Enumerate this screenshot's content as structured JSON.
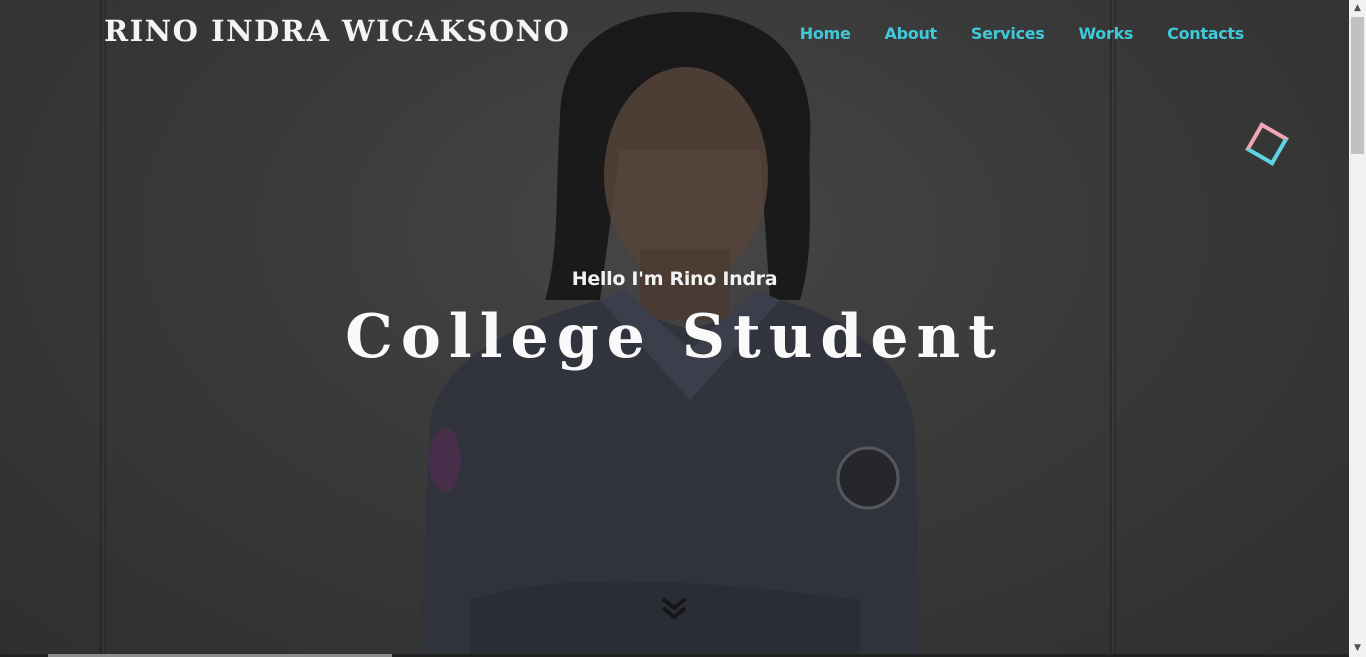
{
  "brand": {
    "name": "RINO INDRA WICAKSONO"
  },
  "nav": {
    "items": [
      {
        "label": "Home"
      },
      {
        "label": "About"
      },
      {
        "label": "Services"
      },
      {
        "label": "Works"
      },
      {
        "label": "Contacts"
      }
    ]
  },
  "hero": {
    "greeting": "Hello I'm Rino Indra",
    "role": "College Student",
    "scroll_icon": "double-chevron-down-icon"
  },
  "decor": {
    "shape_icon": "diamond-outline-icon"
  },
  "colors": {
    "accent": "#3fc9d9",
    "diamond_pink": "#f0a6b3",
    "diamond_cyan": "#5fd3e2",
    "heading": "#fafafa"
  },
  "scrollbar": {
    "up_icon": "scroll-up-arrow-icon",
    "down_icon": "scroll-down-arrow-icon"
  }
}
